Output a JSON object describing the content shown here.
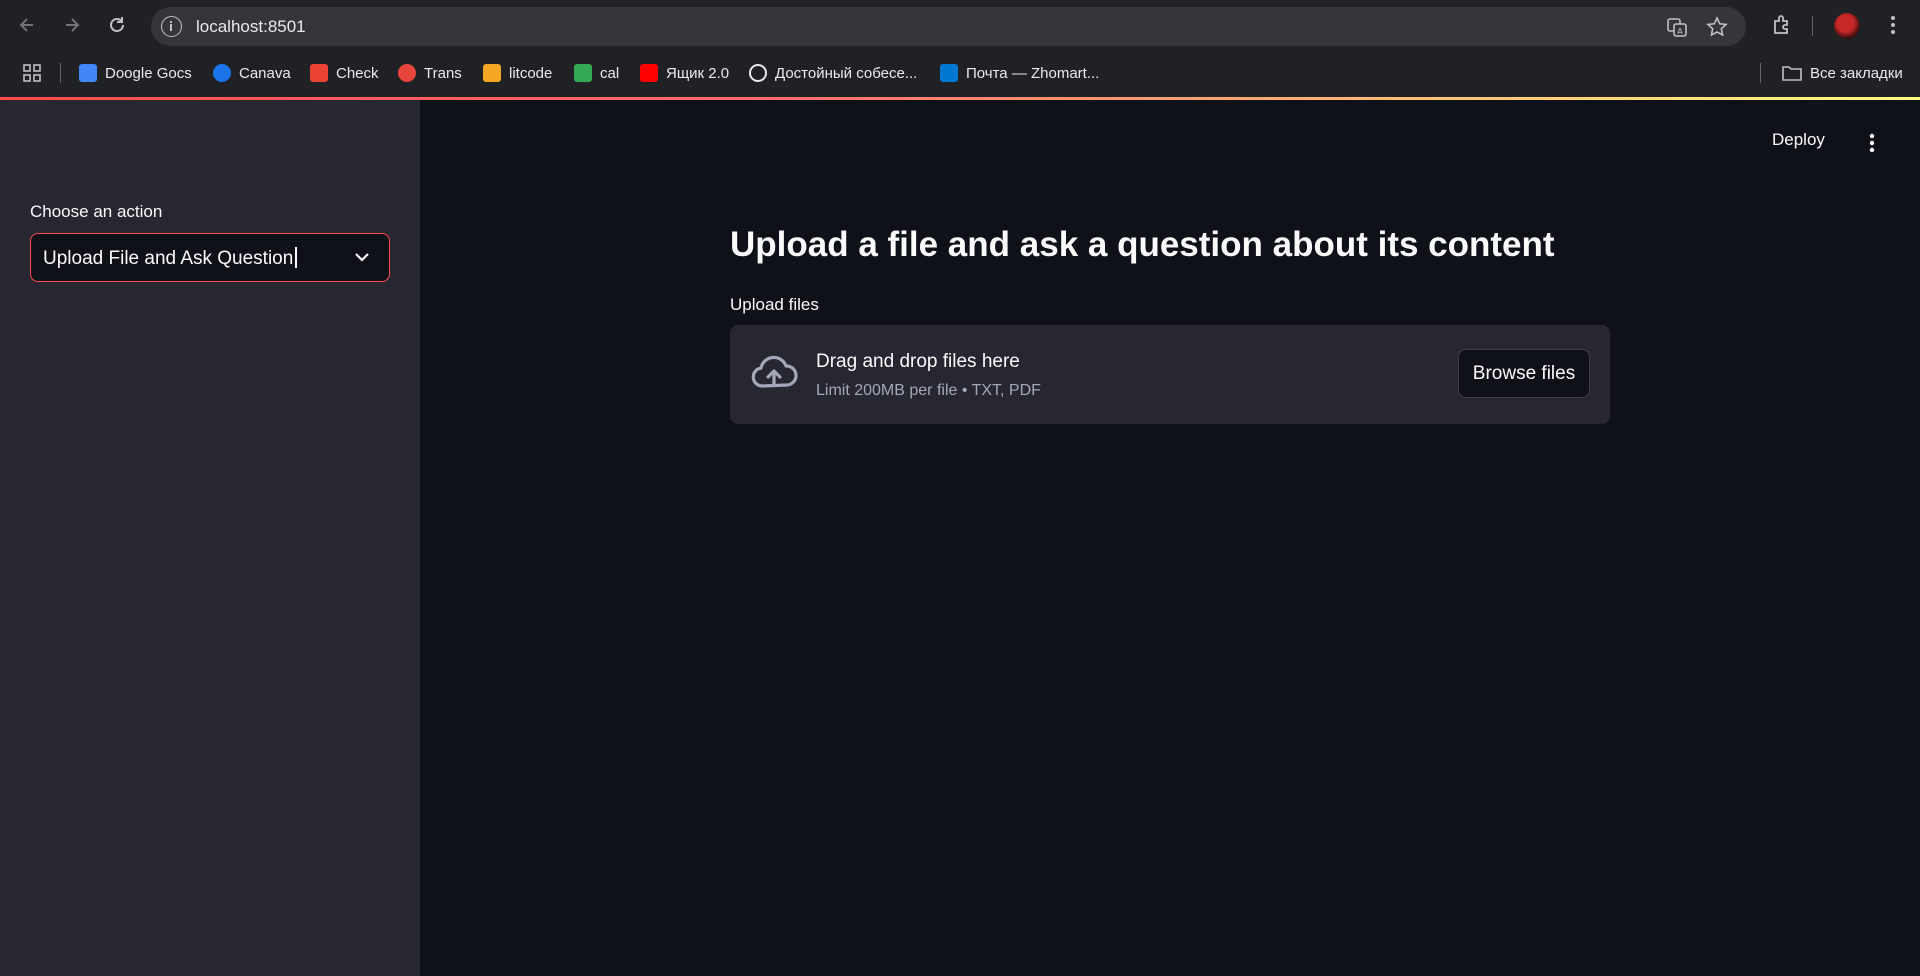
{
  "browser": {
    "url": "localhost:8501",
    "bookmarks": [
      {
        "label": "Doogle Gocs",
        "color": "#4285f4"
      },
      {
        "label": "Canava",
        "color": "#1a73e8"
      },
      {
        "label": "Check",
        "color": "#ea4335"
      },
      {
        "label": "Trans",
        "color": "#e8453c"
      },
      {
        "label": "litcode",
        "color": "#f5a623"
      },
      {
        "label": "cal",
        "color": "#34a853"
      },
      {
        "label": "Ящик 2.0",
        "color": "#ff0000"
      },
      {
        "label": "Достойный собесе...",
        "color": "#e8eaed"
      },
      {
        "label": "Почта — Zhomart...",
        "color": "#0078d4"
      }
    ],
    "all_bookmarks_label": "Все закладки"
  },
  "sidebar": {
    "label": "Choose an action",
    "select_value": "Upload File and Ask Question",
    "accent_color": "#ff4b4b"
  },
  "header": {
    "deploy_label": "Deploy"
  },
  "main": {
    "title": "Upload a file and ask a question about its content",
    "uploader_label": "Upload files",
    "dropzone_title": "Drag and drop files here",
    "dropzone_subtitle": "Limit 200MB per file • TXT, PDF",
    "browse_label": "Browse files"
  }
}
